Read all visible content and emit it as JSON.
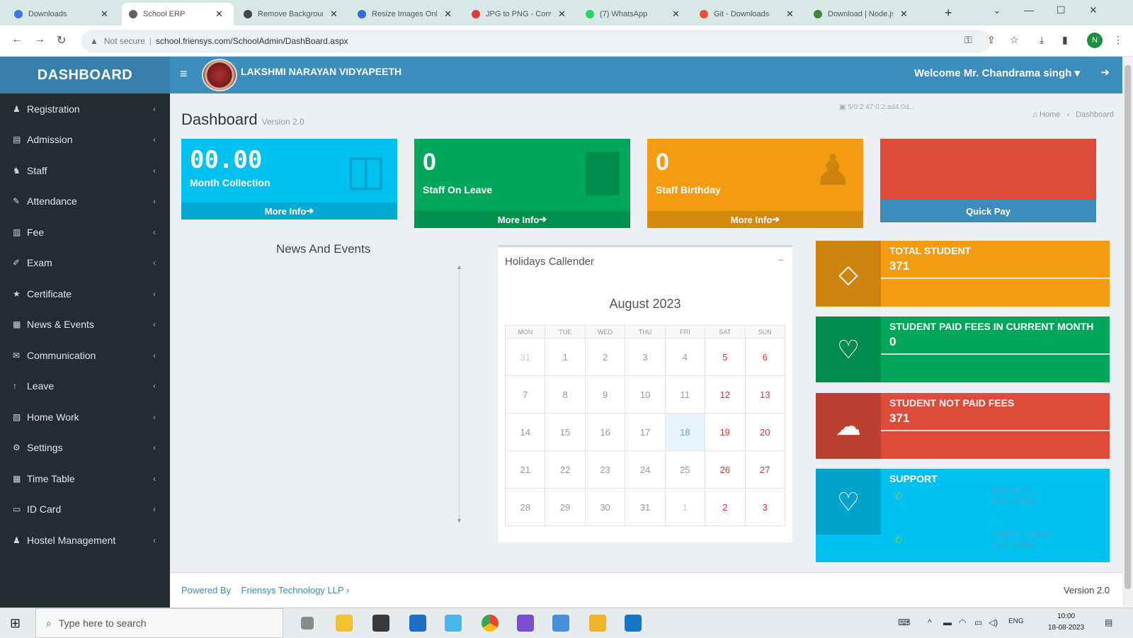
{
  "browser": {
    "tabs": [
      {
        "label": "Downloads",
        "icon": "download-icon",
        "color": "#3b78e7",
        "active": false
      },
      {
        "label": "School ERP",
        "icon": "globe-icon",
        "color": "#5f6368",
        "active": true
      },
      {
        "label": "Remove Background",
        "icon": "cap-icon",
        "color": "#444444",
        "active": false
      },
      {
        "label": "Resize Images Online",
        "icon": "image-icon",
        "color": "#2f6fdc",
        "active": false
      },
      {
        "label": "JPG to PNG - Convert",
        "icon": "convert-icon",
        "color": "#e03b3b",
        "active": false
      },
      {
        "label": "(7) WhatsApp",
        "icon": "whatsapp-icon",
        "color": "#25d366",
        "active": false
      },
      {
        "label": "Git - Downloads",
        "icon": "git-icon",
        "color": "#f05033",
        "active": false
      },
      {
        "label": "Download | Node.js",
        "icon": "node-icon",
        "color": "#3c873a",
        "active": false
      }
    ],
    "new_tab": "+",
    "security_label": "Not secure",
    "url": "school.friensys.com/SchoolAdmin/DashBoard.aspx",
    "profile_initial": "N"
  },
  "sidebar": {
    "logo": "DASHBOARD",
    "items": [
      {
        "label": "Registration",
        "icon": "user-icon"
      },
      {
        "label": "Admission",
        "icon": "id-card-icon"
      },
      {
        "label": "Staff",
        "icon": "users-icon"
      },
      {
        "label": "Attendance",
        "icon": "edit-icon"
      },
      {
        "label": "Fee",
        "icon": "money-icon"
      },
      {
        "label": "Exam",
        "icon": "pencil-icon"
      },
      {
        "label": "Certificate",
        "icon": "star-icon"
      },
      {
        "label": "News & Events",
        "icon": "newspaper-icon"
      },
      {
        "label": "Communication",
        "icon": "chat-icon"
      },
      {
        "label": "Leave",
        "icon": "arrow-up-icon"
      },
      {
        "label": "Home Work",
        "icon": "book-icon"
      },
      {
        "label": "Settings",
        "icon": "gear-icon"
      },
      {
        "label": "Time Table",
        "icon": "table-icon"
      },
      {
        "label": "ID Card",
        "icon": "card-icon"
      },
      {
        "label": "Hostel Management",
        "icon": "user-icon"
      }
    ]
  },
  "header": {
    "school_name": "LAKSHMI NARAYAN VIDYAPEETH",
    "welcome": "Welcome Mr. Chandrama singh ▾"
  },
  "page": {
    "title": "Dashboard",
    "version": "Version 2.0",
    "ip_info": "5/0:2:47:0:2:ad4:0d...",
    "breadcrumb_home": "Home",
    "breadcrumb_current": "Dashboard"
  },
  "smallboxes": [
    {
      "value": "00.00",
      "caption": "Month Collection",
      "more": "More Info",
      "color": "#00c0ef",
      "icon": "shopping-bag-icon"
    },
    {
      "value": "0",
      "caption": "Staff On Leave",
      "more": "More Info",
      "color": "#00a65a",
      "icon": "bar-chart-icon"
    },
    {
      "value": "0",
      "caption": "Staff Birthday",
      "more": "More Info",
      "color": "#f39c12",
      "icon": "user-plus-icon"
    },
    {
      "value": "",
      "caption": "",
      "more": "Quick Pay",
      "color": "#dd4b39",
      "icon": ""
    }
  ],
  "news": {
    "title": "News And Events"
  },
  "calendar": {
    "title": "Holidays Callender",
    "month": "August 2023",
    "weekdays": [
      "MON",
      "TUE",
      "WED",
      "THU",
      "FRI",
      "SAT",
      "SUN"
    ],
    "weeks": [
      [
        "31",
        "1",
        "2",
        "3",
        "4",
        "5",
        "6"
      ],
      [
        "7",
        "8",
        "9",
        "10",
        "11",
        "12",
        "13"
      ],
      [
        "14",
        "15",
        "16",
        "17",
        "18",
        "19",
        "20"
      ],
      [
        "21",
        "22",
        "23",
        "24",
        "25",
        "26",
        "27"
      ],
      [
        "28",
        "29",
        "30",
        "31",
        "1",
        "2",
        "3"
      ]
    ],
    "today": "18"
  },
  "infoboxes": [
    {
      "title": "TOTAL STUDENT",
      "value": "371",
      "color": "#f39c12",
      "icon": "tag-icon"
    },
    {
      "title": "STUDENT PAID FEES IN CURRENT MONTH",
      "value": "0",
      "color": "#00a65a",
      "icon": "heart-icon"
    },
    {
      "title": "STUDENT NOT PAID FEES",
      "value": "371",
      "color": "#dd4b39",
      "icon": "cloud-download-icon"
    },
    {
      "title": "SUPPORT",
      "value": "",
      "color": "#00c0ef",
      "icon": "heart-icon"
    }
  ],
  "support": {
    "contacts": [
      {
        "name": "Amit Shukla",
        "phone": "9935000000"
      },
      {
        "name": "Sonia Shrivastav",
        "phone": "9999000000"
      }
    ]
  },
  "footer": {
    "powered_by": "Powered By",
    "company": "Friensys Technology LLP",
    "version": "Version 2.0"
  },
  "taskbar": {
    "search_placeholder": "Type here to search",
    "time": "10:00",
    "date": "18-08-2023",
    "lang": "ENG"
  }
}
